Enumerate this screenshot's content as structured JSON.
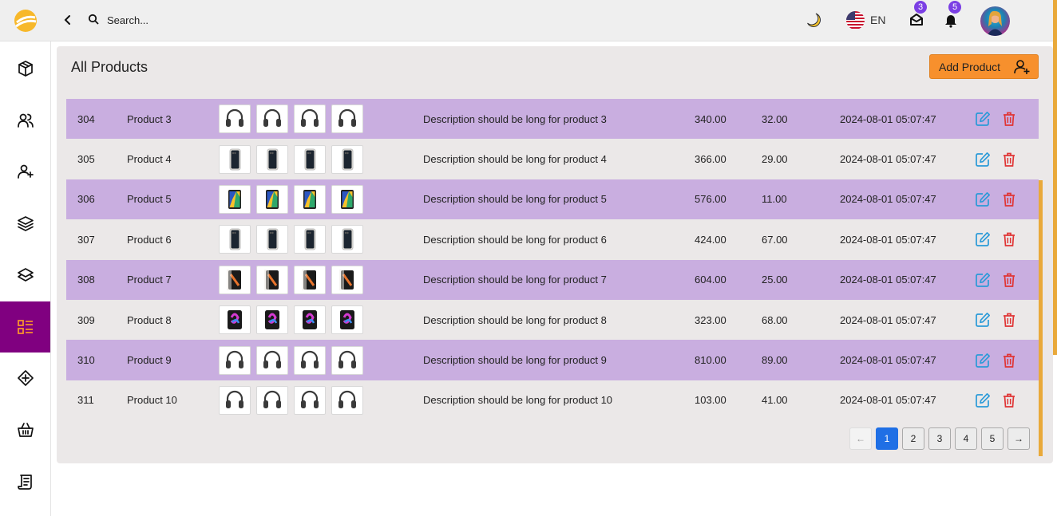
{
  "topbar": {
    "search_placeholder": "Search...",
    "language": "EN",
    "mail_count": "3",
    "notif_count": "5"
  },
  "sidebar": {
    "items": [
      {
        "icon": "box-icon"
      },
      {
        "icon": "users-icon"
      },
      {
        "icon": "user-plus-icon"
      },
      {
        "icon": "layers-icon"
      },
      {
        "icon": "layers-alt-icon"
      },
      {
        "icon": "products-list-icon",
        "active": true
      },
      {
        "icon": "add-circle-icon"
      },
      {
        "icon": "basket-icon"
      },
      {
        "icon": "scroll-icon"
      }
    ]
  },
  "main": {
    "title": "All Products",
    "add_label": "Add Product",
    "rows": [
      {
        "id": "304",
        "name": "Product 3",
        "img": "headphones",
        "description": "Description should be long for product 3",
        "price": "340.00",
        "stock": "32.00",
        "date": "2024-08-01 05:07:47"
      },
      {
        "id": "305",
        "name": "Product 4",
        "img": "iphone",
        "description": "Description should be long for product 4",
        "price": "366.00",
        "stock": "29.00",
        "date": "2024-08-01 05:07:47"
      },
      {
        "id": "306",
        "name": "Product 5",
        "img": "android",
        "description": "Description should be long for product 5",
        "price": "576.00",
        "stock": "11.00",
        "date": "2024-08-01 05:07:47"
      },
      {
        "id": "307",
        "name": "Product 6",
        "img": "iphone",
        "description": "Description should be long for product 6",
        "price": "424.00",
        "stock": "67.00",
        "date": "2024-08-01 05:07:47"
      },
      {
        "id": "308",
        "name": "Product 7",
        "img": "oneplus",
        "description": "Description should be long for product 7",
        "price": "604.00",
        "stock": "25.00",
        "date": "2024-08-01 05:07:47"
      },
      {
        "id": "309",
        "name": "Product 8",
        "img": "ipad",
        "description": "Description should be long for product 8",
        "price": "323.00",
        "stock": "68.00",
        "date": "2024-08-01 05:07:47"
      },
      {
        "id": "310",
        "name": "Product 9",
        "img": "headphones",
        "description": "Description should be long for product 9",
        "price": "810.00",
        "stock": "89.00",
        "date": "2024-08-01 05:07:47"
      },
      {
        "id": "311",
        "name": "Product 10",
        "img": "headphones",
        "description": "Description should be long for product 10",
        "price": "103.00",
        "stock": "41.00",
        "date": "2024-08-01 05:07:47"
      }
    ]
  },
  "pagination": {
    "prev": "←",
    "next": "→",
    "pages": [
      "1",
      "2",
      "3",
      "4",
      "5"
    ],
    "current": "1"
  },
  "colors": {
    "accent": "#f7902d",
    "active_nav": "#800080",
    "row_highlight": "#c9aee0",
    "badge": "#7b3fe4",
    "page_active": "#1f6fe5"
  }
}
